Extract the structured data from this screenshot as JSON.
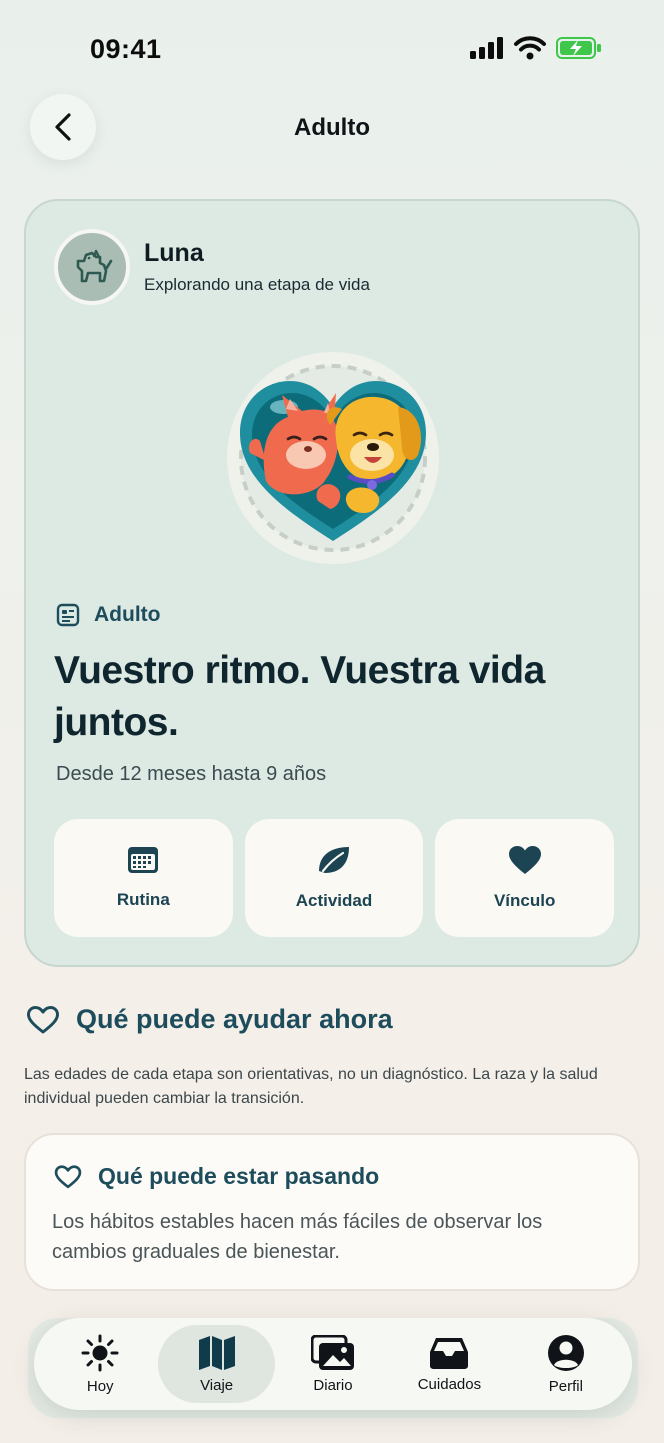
{
  "status_bar": {
    "time": "09:41"
  },
  "header": {
    "title": "Adulto"
  },
  "pet": {
    "name": "Luna",
    "subtitle": "Explorando una etapa de vida"
  },
  "stage": {
    "tag_label": "Adulto",
    "headline": "Vuestro ritmo. Vuestra vida juntos.",
    "range": "Desde 12 meses hasta 9 años",
    "focus_tiles": [
      {
        "label": "Rutina",
        "icon": "calendar-icon"
      },
      {
        "label": "Actividad",
        "icon": "leaf-icon"
      },
      {
        "label": "Vínculo",
        "icon": "heart-icon"
      }
    ]
  },
  "section": {
    "title": "Qué puede ayudar ahora",
    "note": "Las edades de cada etapa son orientativas, no un diagnóstico. La raza y la salud individual pueden cambiar la transición."
  },
  "info_card": {
    "title": "Qué puede estar pasando",
    "body": "Los hábitos estables hacen más fáciles de observar los cambios graduales de bienestar."
  },
  "tabs": [
    {
      "label": "Hoy",
      "icon": "sun-icon",
      "active": false
    },
    {
      "label": "Viaje",
      "icon": "map-icon",
      "active": true
    },
    {
      "label": "Diario",
      "icon": "photos-icon",
      "active": false
    },
    {
      "label": "Cuidados",
      "icon": "tray-icon",
      "active": false
    },
    {
      "label": "Perfil",
      "icon": "person-icon",
      "active": false
    }
  ],
  "colors": {
    "accent": "#1d4d5c",
    "card_bg": "#dde9e3",
    "battery": "#3ec74a"
  }
}
